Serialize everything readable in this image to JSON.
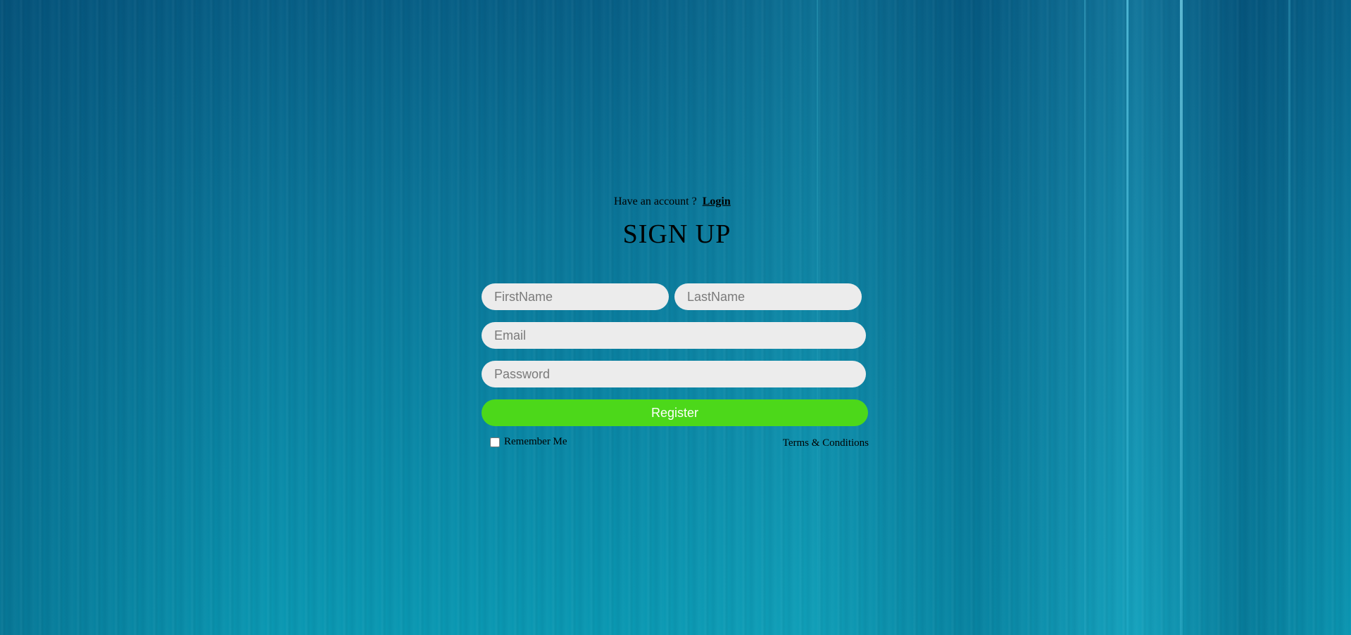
{
  "header": {
    "have_account_text": "Have an account ?",
    "login_link": "Login"
  },
  "form": {
    "title": "SIGN UP",
    "firstname_placeholder": "FirstName",
    "lastname_placeholder": "LastName",
    "email_placeholder": "Email",
    "password_placeholder": "Password",
    "register_label": "Register",
    "remember_label": "Remember Me",
    "remember_checked": false,
    "terms_link": "Terms & Conditions"
  },
  "colors": {
    "background": "#0a7598",
    "input_background": "#ececec",
    "register_button": "#4cd81a"
  }
}
